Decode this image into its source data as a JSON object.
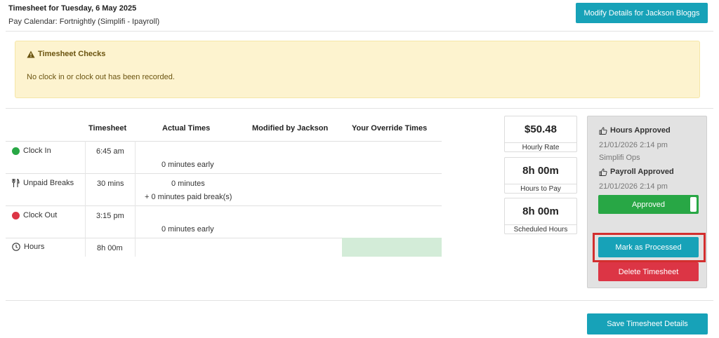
{
  "header": {
    "title": "Timesheet for Tuesday, 6 May 2025",
    "subtitle": "Pay Calendar: Fortnightly (Simplifi - Ipayroll)",
    "modify_button": "Modify Details for Jackson Bloggs"
  },
  "alert": {
    "title": "Timesheet Checks",
    "message": "No clock in or clock out has been recorded."
  },
  "table": {
    "headers": [
      "Timesheet",
      "Actual Times",
      "Modified by Jackson",
      "Your Override Times"
    ],
    "rows": [
      {
        "label": "Clock In",
        "timesheet": "6:45 am",
        "actual": "0 minutes early",
        "actual2": ""
      },
      {
        "label": "Unpaid Breaks",
        "timesheet": "30 mins",
        "actual": "0 minutes",
        "actual2": "+ 0 minutes paid break(s)"
      },
      {
        "label": "Clock Out",
        "timesheet": "3:15 pm",
        "actual": "0 minutes early",
        "actual2": ""
      },
      {
        "label": "Hours",
        "timesheet": "8h 00m",
        "actual": "",
        "actual2": ""
      }
    ]
  },
  "stats": [
    {
      "value": "$50.48",
      "label": "Hourly Rate"
    },
    {
      "value": "8h 00m",
      "label": "Hours to Pay"
    },
    {
      "value": "8h 00m",
      "label": "Scheduled Hours"
    }
  ],
  "approval": {
    "hours_title": "Hours Approved",
    "hours_date": "21/01/2026 2:14 pm",
    "hours_by": "Simplifi Ops",
    "payroll_title": "Payroll Approved",
    "payroll_date": "21/01/2026 2:14 pm",
    "toggle_label": "Approved"
  },
  "actions": {
    "mark_processed": "Mark as Processed",
    "delete": "Delete Timesheet",
    "save": "Save Timesheet Details"
  },
  "colors": {
    "accent": "#17a2b8",
    "success": "#28a745",
    "danger": "#dc3545",
    "clock_in": "#28a745",
    "clock_out": "#dc3545"
  },
  "icons": [
    "warning-icon",
    "clock-in-dot-icon",
    "cutlery-icon",
    "clock-out-dot-icon",
    "clock-icon",
    "thumbs-up-icon"
  ]
}
